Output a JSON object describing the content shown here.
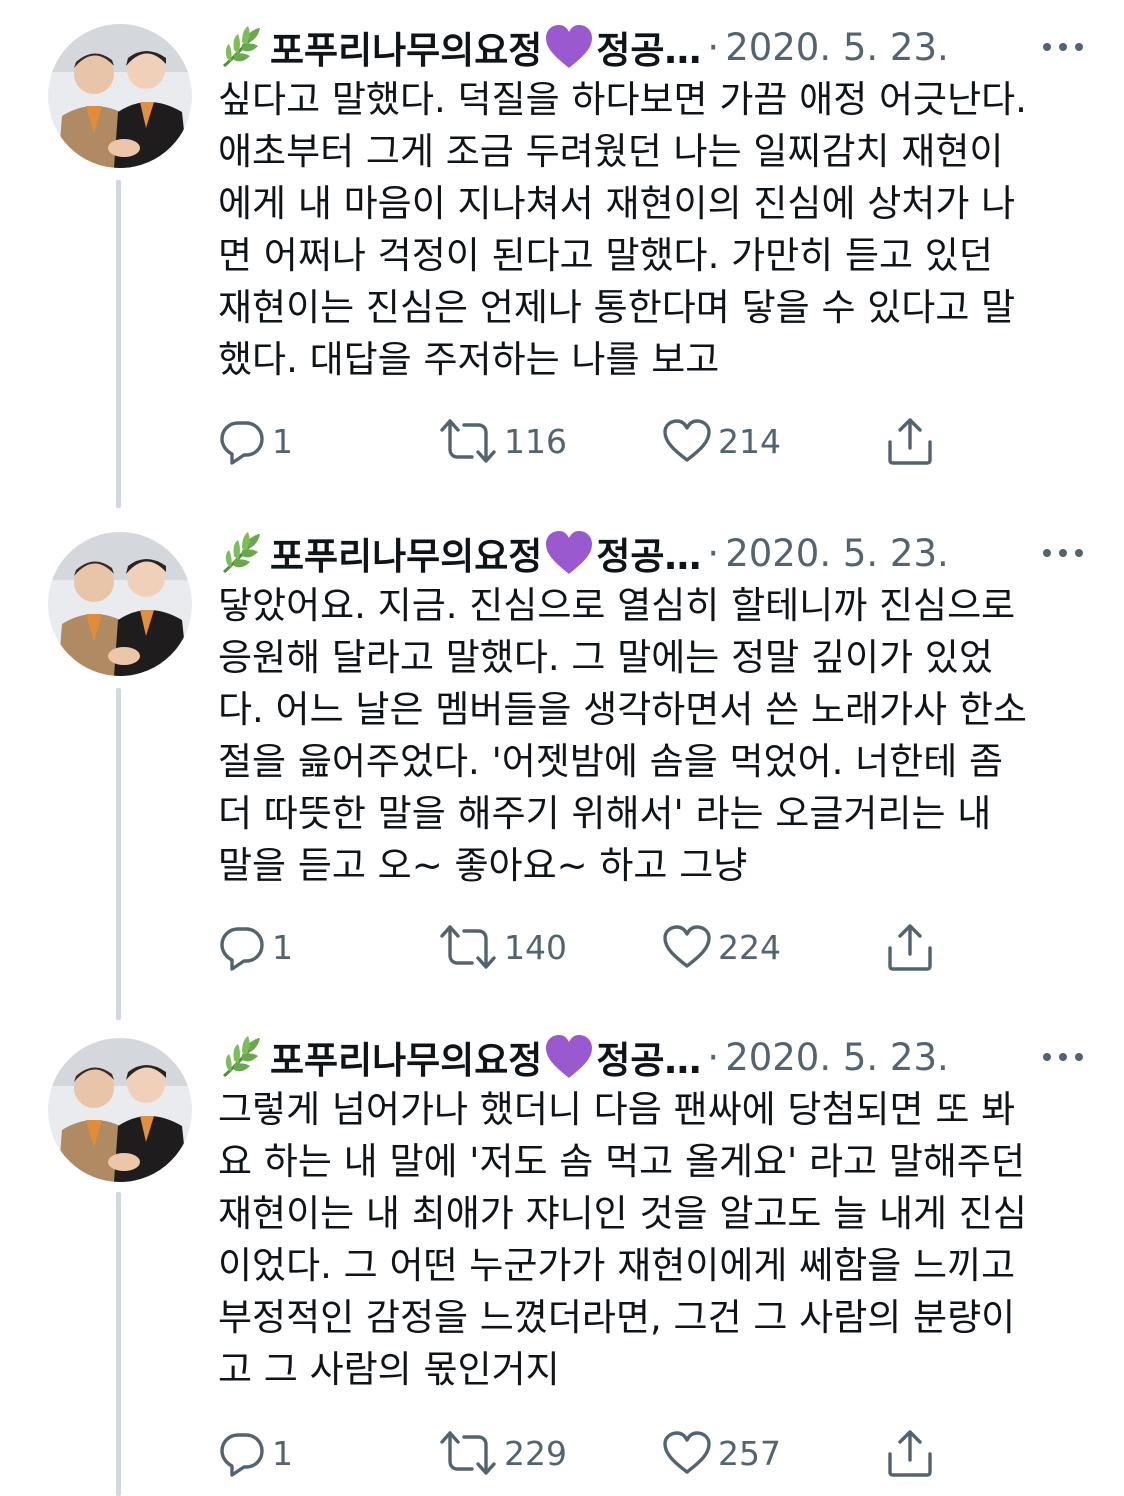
{
  "tweets": [
    {
      "author_name": "포푸리나무의요정",
      "author_name_2": "정공…",
      "separator": "·",
      "date": "2020. 5. 23.",
      "lines": [
        "싶다고 말했다. 덕질을 하다보면 가끔 애정 어긋난다.",
        "애초부터 그게 조금 두려웠던 나는 일찌감치 재현이",
        "에게 내 마음이 지나쳐서 재현이의 진심에 상처가 나",
        "면 어쩌나 걱정이 된다고 말했다. 가만히 듣고 있던",
        "재현이는 진심은 언제나 통한다며 닿을 수 있다고 말",
        "했다. 대답을 주저하는 나를 보고"
      ],
      "replies": "1",
      "retweets": "116",
      "likes": "214"
    },
    {
      "author_name": "포푸리나무의요정",
      "author_name_2": "정공…",
      "separator": "·",
      "date": "2020. 5. 23.",
      "lines": [
        "닿았어요. 지금. 진심으로 열심히 할테니까 진심으로",
        "응원해 달라고 말했다. 그 말에는 정말 깊이가 있었",
        "다. 어느 날은 멤버들을 생각하면서 쓴 노래가사 한소",
        "절을 읊어주었다. '어젯밤에 솜을 먹었어. 너한테 좀",
        "더 따뜻한 말을 해주기 위해서' 라는 오글거리는 내",
        "말을 듣고 오~ 좋아요~ 하고 그냥"
      ],
      "replies": "1",
      "retweets": "140",
      "likes": "224"
    },
    {
      "author_name": "포푸리나무의요정",
      "author_name_2": "정공…",
      "separator": "·",
      "date": "2020. 5. 23.",
      "lines": [
        "그렇게 넘어가나 했더니 다음 팬싸에 당첨되면 또 봐",
        "요 하는 내 말에 '저도 솜 먹고 올게요' 라고 말해주던",
        "재현이는 내 최애가 쟈니인 것을 알고도 늘 내게 진심",
        "이었다. 그 어떤 누군가가 재현이에게 쎄함을 느끼고",
        "부정적인 감정을 느꼈더라면, 그건 그 사람의 분량이",
        "고 그 사람의 몫인거지"
      ],
      "replies": "1",
      "retweets": "229",
      "likes": "257"
    }
  ],
  "icons": {
    "leaf": "herb-icon",
    "heart_emoji": "purple-heart-icon",
    "more": "more-horizontal-icon",
    "reply": "reply-icon",
    "retweet": "retweet-icon",
    "like": "like-icon",
    "share": "share-icon"
  },
  "colors": {
    "text": "#0f1419",
    "secondary": "#536471",
    "thread_line": "#cfd9de",
    "purple_heart": "#9b59d0",
    "leaf_green": "#6aa84f"
  }
}
